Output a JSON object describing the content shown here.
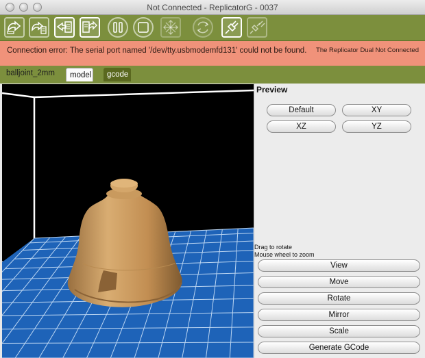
{
  "window": {
    "title": "Not Connected - ReplicatorG - 0037"
  },
  "toolbar": {
    "buttons": [
      {
        "name": "build-icon"
      },
      {
        "name": "build-to-file-icon"
      },
      {
        "name": "upload-to-sd-icon"
      },
      {
        "name": "build-from-sd-icon"
      },
      {
        "name": "pause-icon"
      },
      {
        "name": "stop-icon"
      },
      {
        "name": "control-panel-icon"
      },
      {
        "name": "reset-icon"
      },
      {
        "name": "connect-icon"
      },
      {
        "name": "disconnect-icon"
      }
    ]
  },
  "status": {
    "message": "Connection error: The serial port named '/dev/tty.usbmodemfd131' could not be found.",
    "machine": "The Replicator Dual Not Connected",
    "color": "#f0927a"
  },
  "tabs": {
    "filename": "balljoint_2mm",
    "model": "model",
    "gcode": "gcode"
  },
  "preview": {
    "title": "Preview",
    "views": {
      "default": "Default",
      "xy": "XY",
      "xz": "XZ",
      "yz": "YZ"
    },
    "hint_rotate": "Drag to rotate",
    "hint_zoom": "Mouse wheel to zoom",
    "actions": [
      "View",
      "Move",
      "Rotate",
      "Mirror",
      "Scale",
      "Generate GCode"
    ]
  },
  "colors": {
    "toolbar": "#7c8f3d",
    "platform": "#1e63b8",
    "model": "#c89a5c"
  }
}
